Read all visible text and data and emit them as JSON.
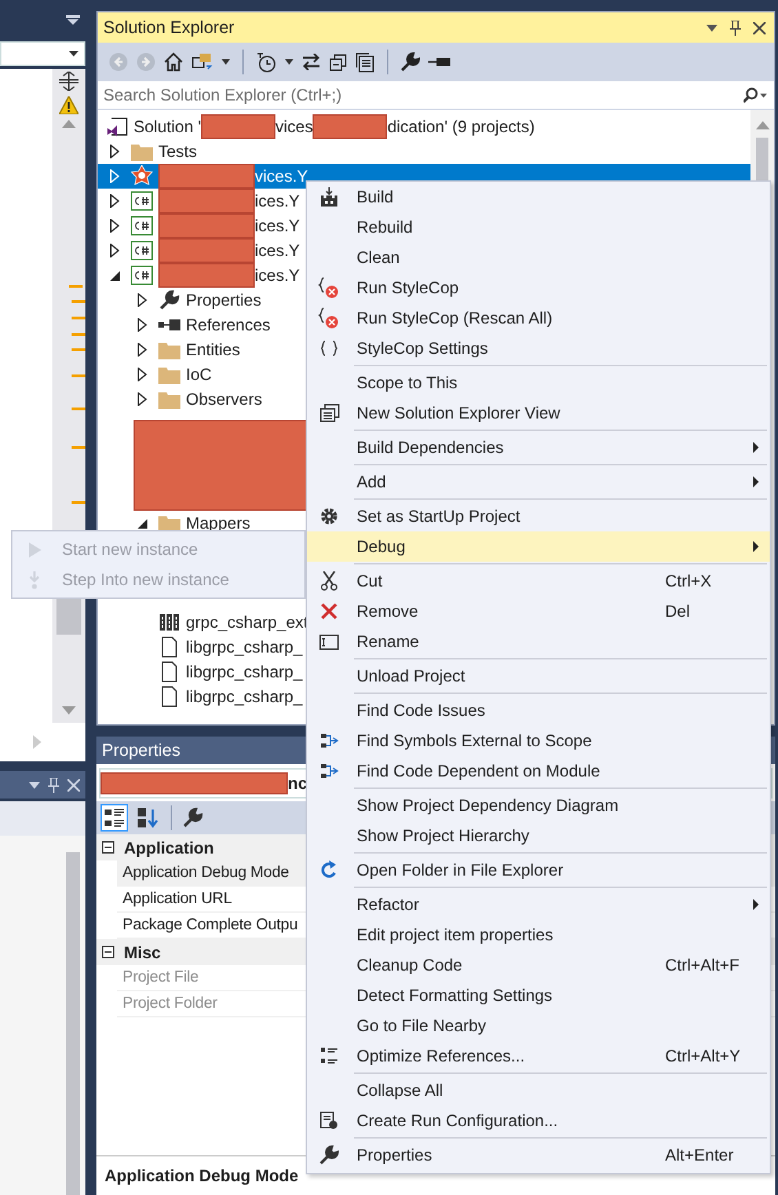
{
  "solution_explorer": {
    "title": "Solution Explorer",
    "search": {
      "placeholder": "Search Solution Explorer (Ctrl+;)"
    },
    "tree": [
      {
        "kind": "solution",
        "selected": false,
        "parts": [
          {
            "kind": "text",
            "text": "Solution '"
          },
          {
            "kind": "redaction"
          },
          {
            "kind": "text",
            "text": "vices"
          },
          {
            "kind": "redaction"
          },
          {
            "kind": "text",
            "text": "dication' (9 projects)"
          }
        ],
        "children": [
          {
            "kind": "folder",
            "selected": false,
            "expanded": false,
            "parts": [
              {
                "kind": "text",
                "text": "Tests"
              }
            ]
          },
          {
            "kind": "web-project",
            "selected": true,
            "expanded": false,
            "parts": [
              {
                "kind": "redaction"
              },
              {
                "kind": "text",
                "text": "vices.Y"
              }
            ]
          },
          {
            "kind": "csharp-project",
            "selected": false,
            "expanded": false,
            "parts": [
              {
                "kind": "redaction"
              },
              {
                "kind": "text",
                "text": "ices.Y"
              }
            ]
          },
          {
            "kind": "csharp-project",
            "selected": false,
            "expanded": false,
            "parts": [
              {
                "kind": "redaction"
              },
              {
                "kind": "text",
                "text": "ices.Y"
              }
            ]
          },
          {
            "kind": "csharp-project",
            "selected": false,
            "expanded": false,
            "parts": [
              {
                "kind": "redaction"
              },
              {
                "kind": "text",
                "text": "ices.Y"
              }
            ]
          },
          {
            "kind": "csharp-project",
            "selected": false,
            "expanded": true,
            "parts": [
              {
                "kind": "redaction"
              },
              {
                "kind": "text",
                "text": "ices.Y"
              }
            ],
            "children": [
              {
                "kind": "properties",
                "selected": false,
                "expanded": false,
                "parts": [
                  {
                    "kind": "text",
                    "text": "Properties"
                  }
                ]
              },
              {
                "kind": "references",
                "selected": false,
                "expanded": false,
                "parts": [
                  {
                    "kind": "text",
                    "text": "References"
                  }
                ]
              },
              {
                "kind": "folder",
                "selected": false,
                "expanded": false,
                "parts": [
                  {
                    "kind": "text",
                    "text": "Entities"
                  }
                ]
              },
              {
                "kind": "folder",
                "selected": false,
                "expanded": false,
                "parts": [
                  {
                    "kind": "text",
                    "text": "IoC"
                  }
                ]
              },
              {
                "kind": "folder",
                "selected": false,
                "expanded": false,
                "parts": [
                  {
                    "kind": "text",
                    "text": "Observers"
                  }
                ]
              },
              {
                "kind": "redaction"
              },
              {
                "kind": "folder",
                "selected": false,
                "expanded": true,
                "parts": [
                  {
                    "kind": "text",
                    "text": "Mappers"
                  }
                ]
              },
              {
                "kind": "dll",
                "selected": false,
                "parts": [
                  {
                    "kind": "text",
                    "text": "grpc_csharp_ext"
                  }
                ]
              },
              {
                "kind": "file",
                "selected": false,
                "parts": [
                  {
                    "kind": "text",
                    "text": "libgrpc_csharp_"
                  }
                ]
              },
              {
                "kind": "file",
                "selected": false,
                "parts": [
                  {
                    "kind": "text",
                    "text": "libgrpc_csharp_"
                  }
                ]
              },
              {
                "kind": "file",
                "selected": false,
                "parts": [
                  {
                    "kind": "text",
                    "text": "libgrpc_csharp_"
                  }
                ]
              }
            ]
          }
        ]
      }
    ]
  },
  "properties": {
    "title": "Properties",
    "object": {
      "parts": [
        {
          "kind": "redaction"
        },
        {
          "kind": "text",
          "text": "nc"
        }
      ]
    },
    "view_buttons": [
      {
        "selected": true
      },
      {
        "selected": false
      }
    ],
    "categories": [
      {
        "name": "Application",
        "expanded": true,
        "rows": [
          {
            "name": "Application Debug Mode",
            "selected": true,
            "disabled": false
          },
          {
            "name": "Application URL",
            "selected": false,
            "disabled": false
          },
          {
            "name": "Package Complete Outpu",
            "selected": false,
            "disabled": false
          }
        ]
      },
      {
        "name": "Misc",
        "expanded": true,
        "rows": [
          {
            "name": "Project File",
            "selected": false,
            "disabled": true
          },
          {
            "name": "Project Folder",
            "selected": false,
            "disabled": true
          }
        ]
      }
    ],
    "description": "Application Debug Mode"
  },
  "context_menu": {
    "items": [
      {
        "kind": "item",
        "label": "Build",
        "selected": false
      },
      {
        "kind": "item",
        "label": "Rebuild",
        "selected": false
      },
      {
        "kind": "item",
        "label": "Clean",
        "selected": false
      },
      {
        "kind": "item",
        "label": "Run StyleCop",
        "selected": false
      },
      {
        "kind": "item",
        "label": "Run StyleCop (Rescan All)",
        "selected": false
      },
      {
        "kind": "item",
        "label": "StyleCop Settings",
        "selected": false
      },
      {
        "kind": "separator"
      },
      {
        "kind": "item",
        "label": "Scope to This",
        "selected": false
      },
      {
        "kind": "item",
        "label": "New Solution Explorer View",
        "selected": false
      },
      {
        "kind": "separator"
      },
      {
        "kind": "item",
        "label": "Build Dependencies",
        "selected": false,
        "submenu": true
      },
      {
        "kind": "separator"
      },
      {
        "kind": "item",
        "label": "Add",
        "selected": false,
        "submenu": true
      },
      {
        "kind": "separator"
      },
      {
        "kind": "item",
        "label": "Set as StartUp Project",
        "selected": false
      },
      {
        "kind": "item",
        "label": "Debug",
        "selected": true,
        "submenu": true
      },
      {
        "kind": "separator"
      },
      {
        "kind": "item",
        "label": "Cut",
        "shortcut": "Ctrl+X",
        "selected": false
      },
      {
        "kind": "item",
        "label": "Remove",
        "shortcut": "Del",
        "selected": false
      },
      {
        "kind": "item",
        "label": "Rename",
        "selected": false
      },
      {
        "kind": "separator"
      },
      {
        "kind": "item",
        "label": "Unload Project",
        "selected": false
      },
      {
        "kind": "separator"
      },
      {
        "kind": "item",
        "label": "Find Code Issues",
        "selected": false
      },
      {
        "kind": "item",
        "label": "Find Symbols External to Scope",
        "selected": false
      },
      {
        "kind": "item",
        "label": "Find Code Dependent on Module",
        "selected": false
      },
      {
        "kind": "separator"
      },
      {
        "kind": "item",
        "label": "Show Project Dependency Diagram",
        "selected": false
      },
      {
        "kind": "item",
        "label": "Show Project Hierarchy",
        "selected": false
      },
      {
        "kind": "separator"
      },
      {
        "kind": "item",
        "label": "Open Folder in File Explorer",
        "selected": false
      },
      {
        "kind": "separator"
      },
      {
        "kind": "item",
        "label": "Refactor",
        "selected": false,
        "submenu": true
      },
      {
        "kind": "item",
        "label": "Edit project item properties",
        "selected": false
      },
      {
        "kind": "item",
        "label": "Cleanup Code",
        "shortcut": "Ctrl+Alt+F",
        "selected": false
      },
      {
        "kind": "item",
        "label": "Detect Formatting Settings",
        "selected": false
      },
      {
        "kind": "item",
        "label": "Go to File Nearby",
        "selected": false
      },
      {
        "kind": "item",
        "label": "Optimize References...",
        "shortcut": "Ctrl+Alt+Y",
        "selected": false
      },
      {
        "kind": "separator"
      },
      {
        "kind": "item",
        "label": "Collapse All",
        "selected": false
      },
      {
        "kind": "item",
        "label": "Create Run Configuration...",
        "selected": false
      },
      {
        "kind": "separator"
      },
      {
        "kind": "item",
        "label": "Properties",
        "shortcut": "Alt+Enter",
        "selected": false
      }
    ]
  },
  "debug_submenu": {
    "items": [
      {
        "label": "Start new instance",
        "disabled": true
      },
      {
        "label": "Step Into new instance",
        "disabled": true
      }
    ]
  }
}
